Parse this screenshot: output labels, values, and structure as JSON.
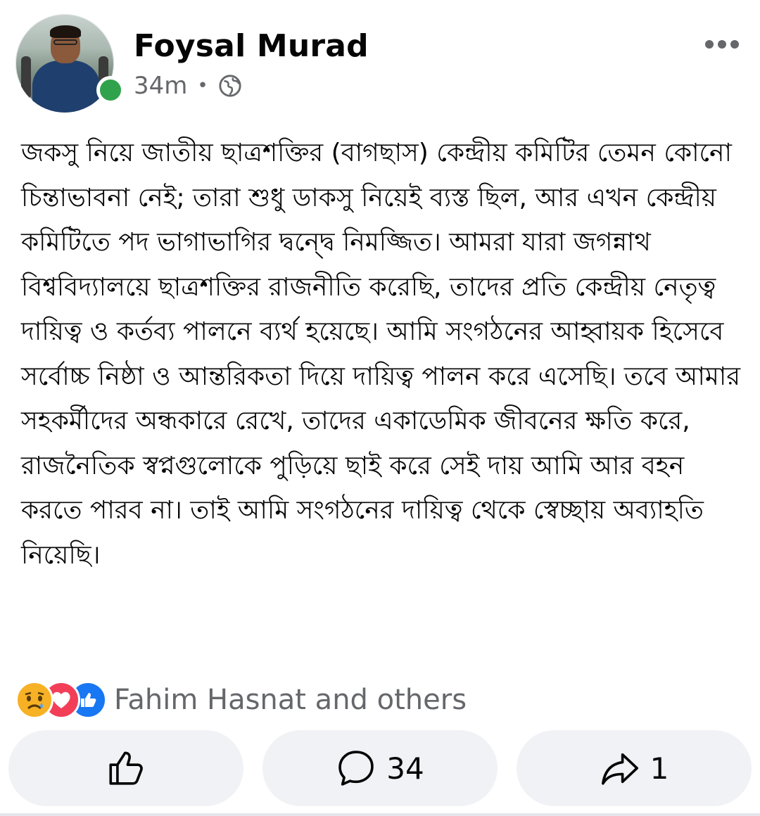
{
  "post": {
    "author": "Foysal Murad",
    "time": "34m",
    "separator": "•",
    "privacy_icon": "globe-icon",
    "more_icon": "more-dots-icon",
    "text": "জকসু নিয়ে জাতীয় ছাত্রশক্তির (বাগছাস) কেন্দ্রীয় কমিটির তেমন কোনো চিন্তাভাবনা নেই; তারা শুধু ডাকসু নিয়েই ব্যস্ত ছিল, আর এখন কেন্দ্রীয় কমিটিতে পদ ভাগাভাগির দ্বন্দ্বে নিমজ্জিত। আমরা যারা জগন্নাথ বিশ্ববিদ্যালয়ে ছাত্রশক্তির রাজনীতি করেছি, তাদের প্রতি কেন্দ্রীয় নেতৃত্ব দায়িত্ব ও কর্তব্য পালনে ব্যর্থ হয়েছে। আমি সংগঠনের আহ্বায়ক হিসেবে সর্বোচ্চ নিষ্ঠা ও আন্তরিকতা দিয়ে দায়িত্ব পালন করে এসেছি। তবে আমার সহকর্মীদের অন্ধকারে রেখে, তাদের একাডেমিক জীবনের ক্ষতি করে, রাজনৈতিক স্বপ্নগুলোকে পুড়িয়ে ছাই করে সেই দায় আমি আর বহন করতে পারব না। তাই আমি সংগঠনের দায়িত্ব থেকে স্বেচ্ছায় অব্যাহতি নিয়েছি।"
  },
  "reactions": {
    "icons": [
      "sad-icon",
      "love-icon",
      "like-icon"
    ],
    "summary": "Fahim Hasnat and others"
  },
  "actions": {
    "like_icon": "thumbs-up-icon",
    "comment_icon": "comment-icon",
    "comment_count": "34",
    "share_icon": "share-icon",
    "share_count": "1"
  },
  "colors": {
    "online": "#31a24c",
    "like_blue": "#1877f2",
    "love_red": "#f33e58",
    "sad_yellow": "#f7b125",
    "secondary_text": "#65676b",
    "button_bg": "#f0f2f5"
  }
}
